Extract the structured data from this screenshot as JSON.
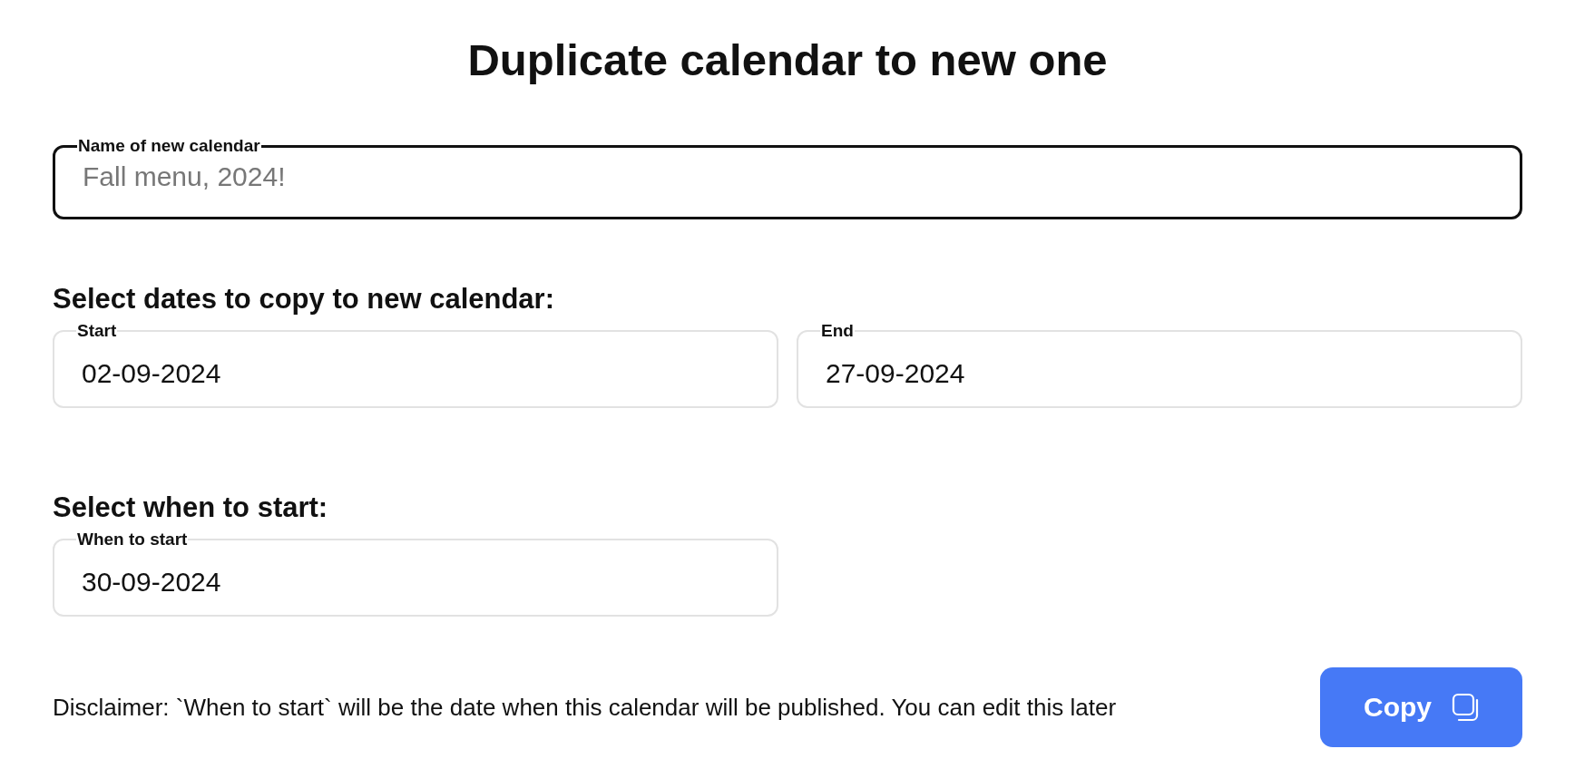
{
  "title": "Duplicate calendar to new one",
  "name_field": {
    "label": "Name of new calendar",
    "placeholder": "Fall menu, 2024!",
    "focused": true
  },
  "dates_section": {
    "heading": "Select dates to copy to new calendar:",
    "fields": [
      {
        "label": "Start",
        "value": "02-09-2024",
        "focused": false
      },
      {
        "label": "End",
        "value": "27-09-2024",
        "focused": false
      }
    ]
  },
  "start_section": {
    "heading": "Select when to start:",
    "fields": [
      {
        "label": "When to start",
        "value": "30-09-2024",
        "focused": false
      }
    ]
  },
  "disclaimer": "Disclaimer: `When to start` will be the date when this calendar will be published. You can edit this later",
  "button": {
    "label": "Copy"
  }
}
